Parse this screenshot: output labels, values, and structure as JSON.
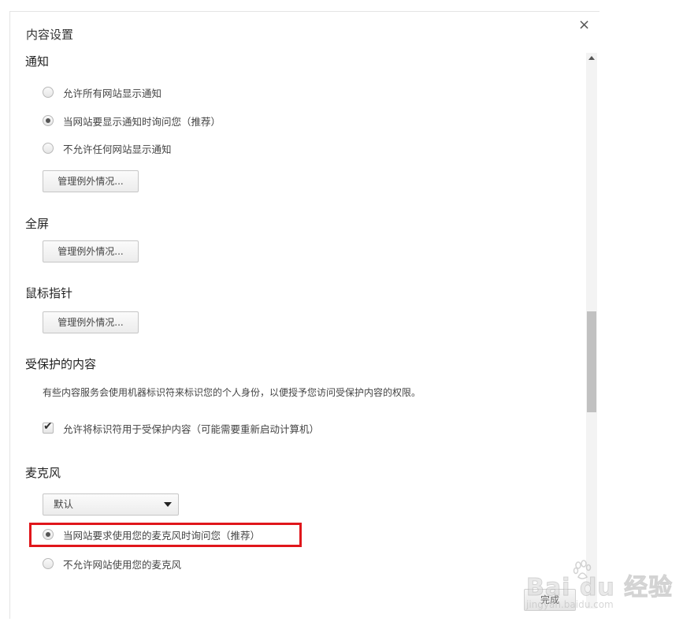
{
  "dialog": {
    "title": "内容设置",
    "close_glyph": "×"
  },
  "notifications": {
    "heading": "通知",
    "options": [
      {
        "label": "允许所有网站显示通知",
        "checked": false
      },
      {
        "label": "当网站要显示通知时询问您（推荐）",
        "checked": true
      },
      {
        "label": "不允许任何网站显示通知",
        "checked": false
      }
    ],
    "manage_button": "管理例外情况..."
  },
  "fullscreen": {
    "heading": "全屏",
    "manage_button": "管理例外情况..."
  },
  "mouse_cursor": {
    "heading": "鼠标指针",
    "manage_button": "管理例外情况..."
  },
  "protected_content": {
    "heading": "受保护的内容",
    "description": "有些内容服务会使用机器标识符来标识您的个人身份，以便授予您访问受保护内容的权限。",
    "checkbox_label": "允许将标识符用于受保护内容（可能需要重新启动计算机）",
    "checkbox_checked": true
  },
  "microphone": {
    "heading": "麦克风",
    "select_value": "默认",
    "options": [
      {
        "label": "当网站要求使用您的麦克风时询问您（推荐）",
        "checked": true,
        "highlighted": true
      },
      {
        "label": "不允许网站使用您的麦克风",
        "checked": false
      }
    ]
  },
  "footer": {
    "done_button": "完成"
  },
  "watermark": {
    "text": "Bai du 经验",
    "url": "jingyan.baidu.com"
  },
  "colors": {
    "highlight_border": "#e0161b",
    "scroll_thumb": "#c1c1c1"
  }
}
